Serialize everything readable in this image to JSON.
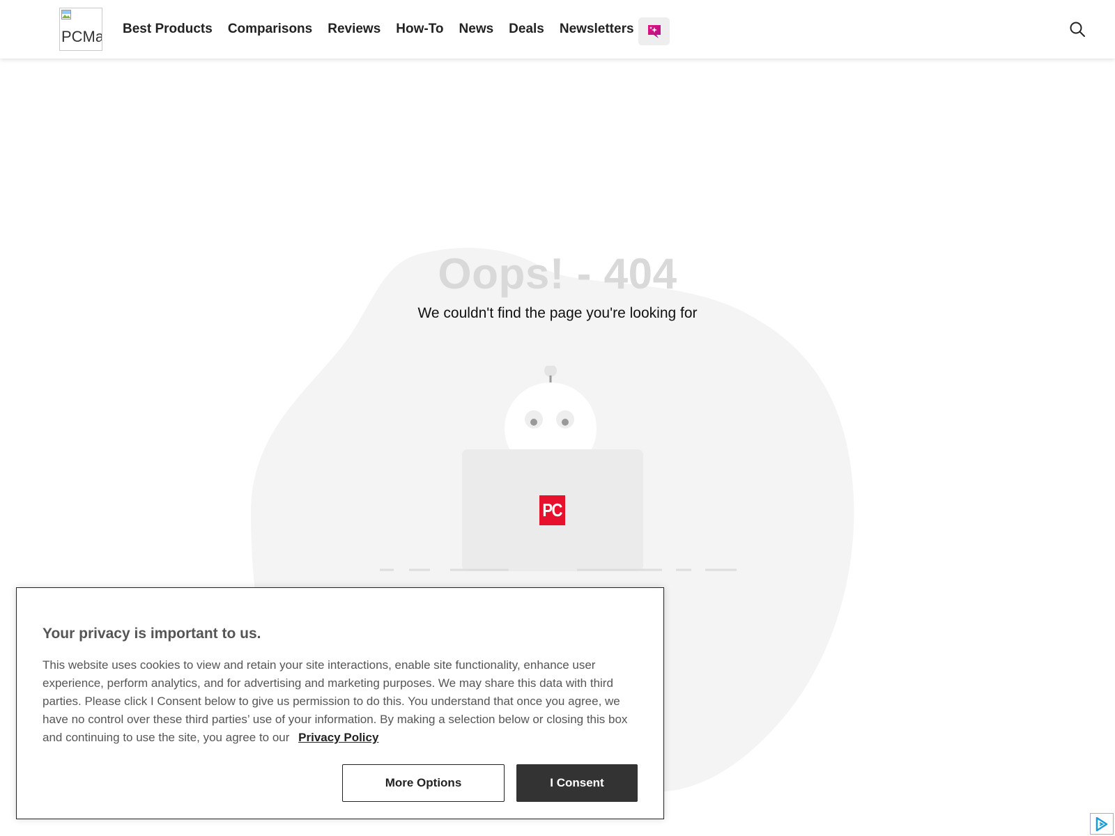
{
  "header": {
    "logo_alt": "PCMa",
    "nav": [
      {
        "label": "Best Products"
      },
      {
        "label": "Comparisons"
      },
      {
        "label": "Reviews"
      },
      {
        "label": "How-To"
      },
      {
        "label": "News"
      },
      {
        "label": "Deals"
      },
      {
        "label": "Newsletters"
      }
    ],
    "ai_icon": "sparkle-chat-icon",
    "search_icon": "search-icon"
  },
  "error": {
    "title": "Oops! - 404",
    "subtitle": "We couldn't find the page you're looking for",
    "laptop_logo": "PC"
  },
  "cookie": {
    "title": "Your privacy is important to us.",
    "body": "This website uses cookies to view and retain your site interactions, enable site functionality, enhance user experience, perform analytics, and for advertising and marketing purposes. We may share this data with third parties. Please click I Consent below to give us permission to do this. You understand that once you agree, we have no control over these third parties’ use of your information. By making a selection below or closing this box and continuing to use the site, you agree to our ",
    "policy_link": "Privacy Policy",
    "more_options": "More Options",
    "consent": "I Consent"
  },
  "colors": {
    "brand_red": "#e8112d",
    "ai_pink": "#e0157a",
    "consent_bg": "#333333",
    "blob": "#f4f4f4"
  },
  "adchoices_icon": "adchoices-icon"
}
